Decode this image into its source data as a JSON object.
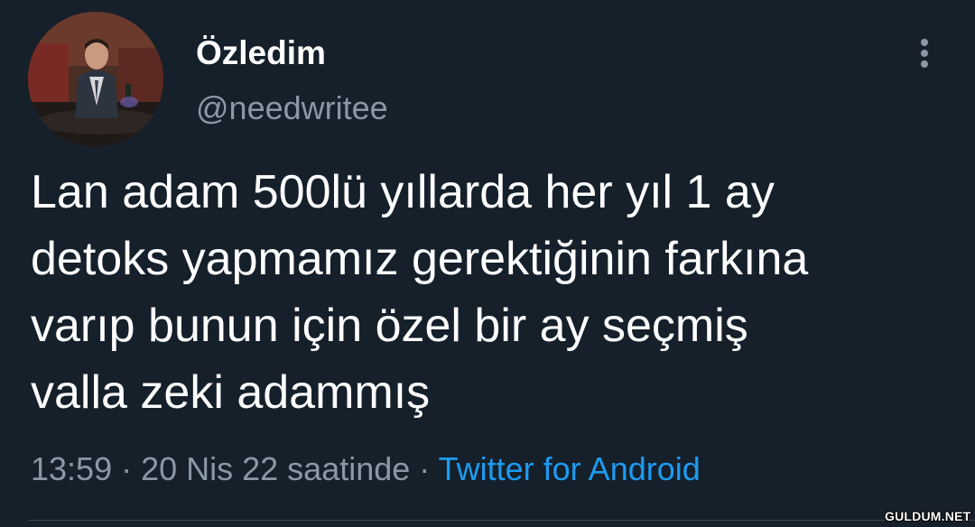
{
  "tweet": {
    "author": {
      "display_name": "Özledim",
      "handle": "@needwritee",
      "avatar": "profile-photo"
    },
    "more_icon": "more-vertical-icon",
    "text_lines": [
      "Lan adam 500lü yıllarda her yıl 1 ay",
      "detoks yapmamız gerektiğinin farkına",
      "varıp bunun için özel bir ay seçmiş",
      "valla zeki adammış"
    ],
    "meta": {
      "time": "13:59",
      "separator_1": " · ",
      "date": "20 Nis 22 saatinde",
      "separator_2": " · ",
      "source": "Twitter for Android"
    }
  },
  "watermark": "GULDUM.NET",
  "colors": {
    "background": "#15202b",
    "primary_text": "#ffffff",
    "secondary_text": "#8b98a5",
    "link": "#1d9bf0",
    "divider": "#38444d"
  }
}
